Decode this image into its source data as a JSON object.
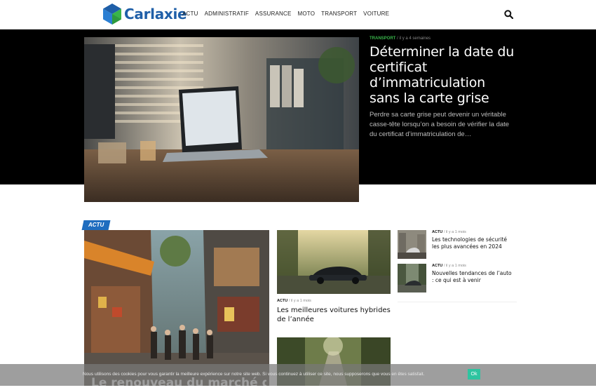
{
  "header": {
    "logo_text": "Carlaxie",
    "nav": [
      "ACTU",
      "ADMINISTRATIF",
      "ASSURANCE",
      "MOTO",
      "TRANSPORT",
      "VOITURE"
    ]
  },
  "hero": {
    "category": "TRANSPORT",
    "date": "il y a 4 semaines",
    "title": "Déterminer la date du certificat d’immatriculation sans la carte grise",
    "excerpt": "Perdre sa carte grise peut devenir un véritable casse-tête lorsqu’on a besoin de vérifier la date du certificat d’immatriculation de…"
  },
  "section": {
    "badge": "ACTU",
    "big_card_title": "Le renouveau du marché de",
    "mid_card": {
      "category": "ACTU",
      "date": "il y a 1 mois",
      "title": "Les meilleures voitures hybrides de l’année"
    },
    "side_items": [
      {
        "category": "ACTU",
        "date": "il y a 1 mois",
        "title": "Les technologies de sécurité les plus avancées en 2024"
      },
      {
        "category": "ACTU",
        "date": "il y a 1 mois",
        "title": "Nouvelles tendances de l’auto : ce qui est à venir"
      }
    ]
  },
  "cookie": {
    "text": "Nous utilisons des cookies pour vous garantir la meilleure expérience sur notre site web. Si vous continuez à utiliser ce site, nous supposerons que vous en êtes satisfait.",
    "ok_label": "Ok"
  },
  "colors": {
    "brand_blue": "#1f5fa8",
    "brand_green": "#39b54a",
    "badge_blue": "#1f6dbf",
    "cookie_ok": "#2ec4a0"
  },
  "icons": {
    "search": "search-icon",
    "logo": "carlaxie-logo-mark"
  }
}
